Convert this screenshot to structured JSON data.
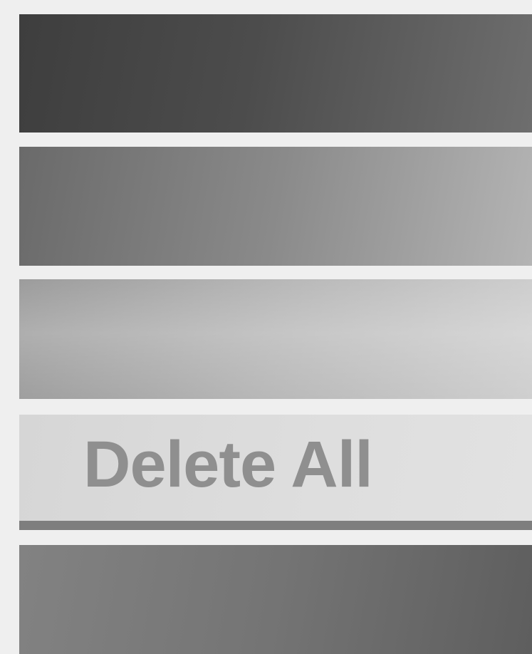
{
  "menu": {
    "items": [
      {
        "label": "",
        "state": "normal"
      },
      {
        "label": "",
        "state": "normal"
      },
      {
        "label": "",
        "state": "normal"
      },
      {
        "label": "Delete All",
        "state": "highlighted"
      },
      {
        "label": "",
        "state": "normal"
      }
    ]
  },
  "colors": {
    "background": "#efefef",
    "highlight_fill": "#dcdcdc",
    "highlight_text": "#8f8f8f",
    "highlight_underline": "#7e7e7e"
  }
}
